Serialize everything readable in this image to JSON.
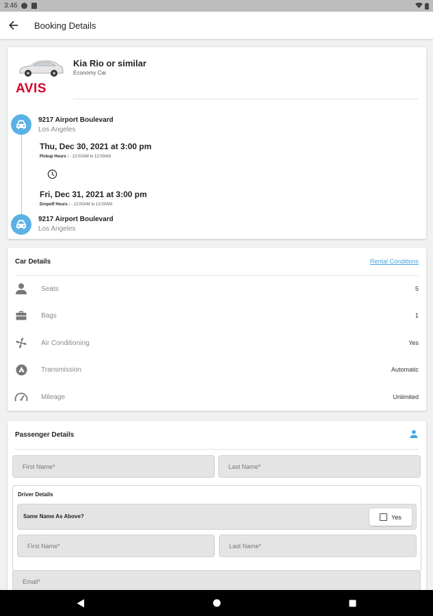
{
  "status_bar": {
    "time": "3:46"
  },
  "app_bar": {
    "title": "Booking Details"
  },
  "booking": {
    "car_name": "Kia Rio or similar",
    "car_class": "Economy Car",
    "vendor_logo_text": "AVIS",
    "pickup": {
      "address": "9217 Airport Boulevard",
      "city": "Los Angeles",
      "datetime": "Thu, Dec 30, 2021 at 3:00 pm",
      "hours_label": "Pickup Hours :",
      "hours_value": "- 12:00AM to 12:00AM"
    },
    "dropoff": {
      "datetime": "Fri, Dec 31, 2021 at 3:00 pm",
      "hours_label": "Dropoff Hours :",
      "hours_value": "- 12:00AM to 12:00AM",
      "address": "9217 Airport Boulevard",
      "city": "Los Angeles"
    }
  },
  "car_details": {
    "title": "Car Details",
    "rental_conditions_link": "Rental Conditions",
    "rows": [
      {
        "icon": "person-icon",
        "label": "Seats",
        "value": "5"
      },
      {
        "icon": "briefcase-icon",
        "label": "Bags",
        "value": "1"
      },
      {
        "icon": "fan-icon",
        "label": "Air Conditioning",
        "value": "Yes"
      },
      {
        "icon": "transmission-icon",
        "label": "Transmission",
        "value": "Automatic"
      },
      {
        "icon": "speedometer-icon",
        "label": "Mileage",
        "value": "Unlimited"
      }
    ]
  },
  "passenger": {
    "title": "Passenger Details",
    "first_name_placeholder": "First Name*",
    "last_name_placeholder": "Last Name*",
    "driver_details_title": "Driver Details",
    "same_name_label": "Same Name As Above?",
    "same_name_checkbox_label": "Yes",
    "driver_first_name_placeholder": "First Name*",
    "driver_last_name_placeholder": "Last Name*",
    "email_placeholder": "Email*"
  },
  "colors": {
    "accent": "#5ab1e6",
    "link": "#3fa3df",
    "avis_red": "#d4002a"
  }
}
